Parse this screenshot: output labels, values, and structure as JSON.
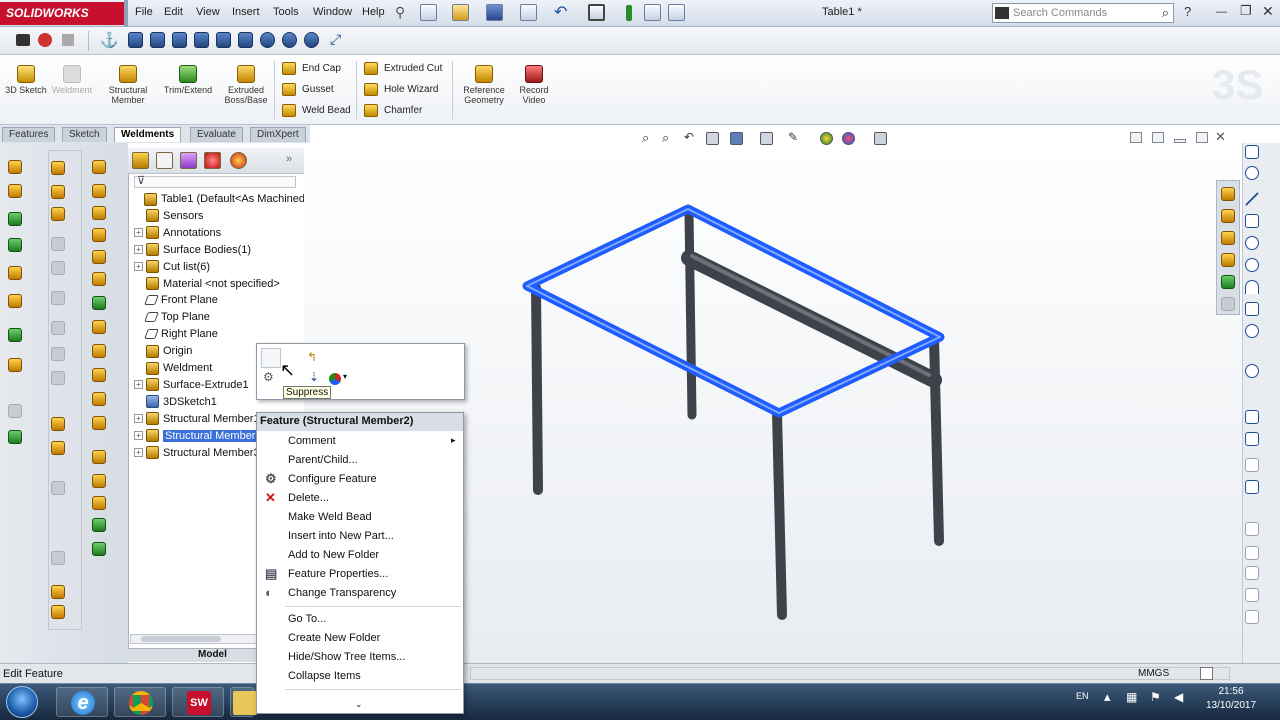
{
  "app": {
    "logo_text": "SOLIDWORKS",
    "doc_title": "Table1 *"
  },
  "menu": [
    "File",
    "Edit",
    "View",
    "Insert",
    "Tools",
    "Window",
    "Help"
  ],
  "search": {
    "placeholder": "Search Commands"
  },
  "command_manager": {
    "big_buttons": [
      {
        "label": "3D Sketch",
        "disabled": false
      },
      {
        "label": "Weldment",
        "disabled": true
      },
      {
        "label": "Structural Member",
        "disabled": false
      },
      {
        "label": "Trim/Extend",
        "disabled": false
      },
      {
        "label": "Extruded Boss/Base",
        "disabled": false
      }
    ],
    "col1": [
      "End Cap",
      "Gusset",
      "Weld Bead"
    ],
    "col2": [
      "Extruded Cut",
      "Hole Wizard",
      "Chamfer"
    ],
    "right_buttons": [
      {
        "label": "Reference Geometry"
      },
      {
        "label": "Record Video"
      }
    ]
  },
  "tabs": [
    "Features",
    "Sketch",
    "Weldments",
    "Evaluate",
    "DimXpert"
  ],
  "active_tab": "Weldments",
  "tree": {
    "nodes": [
      {
        "label": "Table1  (Default<As Machined>)",
        "icon": "part",
        "expand": false
      },
      {
        "label": "Sensors",
        "icon": "folder",
        "expand": false
      },
      {
        "label": "Annotations",
        "icon": "folder",
        "expand": true
      },
      {
        "label": "Surface Bodies(1)",
        "icon": "folder",
        "expand": true
      },
      {
        "label": "Cut list(6)",
        "icon": "folder",
        "expand": true
      },
      {
        "label": "Material <not specified>",
        "icon": "material",
        "expand": false
      },
      {
        "label": "Front Plane",
        "icon": "plane",
        "expand": false
      },
      {
        "label": "Top Plane",
        "icon": "plane",
        "expand": false
      },
      {
        "label": "Right Plane",
        "icon": "plane",
        "expand": false
      },
      {
        "label": "Origin",
        "icon": "origin",
        "expand": false
      },
      {
        "label": "Weldment",
        "icon": "feature",
        "expand": false
      },
      {
        "label": "Surface-Extrude1",
        "icon": "feature",
        "expand": true
      },
      {
        "label": "3DSketch1",
        "icon": "sketch",
        "expand": false
      },
      {
        "label": "Structural Member1",
        "icon": "feature",
        "expand": true
      },
      {
        "label": "Structural Member2",
        "icon": "feature",
        "expand": true,
        "selected": true
      },
      {
        "label": "Structural Member3",
        "icon": "feature",
        "expand": true
      }
    ],
    "model_tab": "Model"
  },
  "tooltip": "Suppress",
  "context_menu": {
    "header": "Feature (Structural Member2)",
    "items": [
      {
        "label": "Comment",
        "submenu": true
      },
      {
        "label": "Parent/Child..."
      },
      {
        "label": "Configure Feature",
        "icon": "configure-icon"
      },
      {
        "label": "Delete...",
        "icon": "delete-icon"
      },
      {
        "label": "Make Weld Bead"
      },
      {
        "label": "Insert into New Part..."
      },
      {
        "label": "Add to New Folder"
      },
      {
        "label": "Feature Properties...",
        "icon": "properties-icon"
      },
      {
        "label": "Change Transparency",
        "icon": "transparency-icon"
      },
      {
        "label": "Go To..."
      },
      {
        "label": "Create New Folder"
      },
      {
        "label": "Hide/Show Tree Items..."
      },
      {
        "label": "Collapse Items"
      }
    ]
  },
  "status": {
    "left": "Edit Feature",
    "units": "MMGS"
  },
  "taskbar": {
    "lang": "EN",
    "time": "21:56",
    "date": "13/10/2017"
  },
  "colors": {
    "selection_blue": "#1f5cff",
    "tube_gray": "#4a4f57",
    "highlight": "#3a6fd8"
  }
}
